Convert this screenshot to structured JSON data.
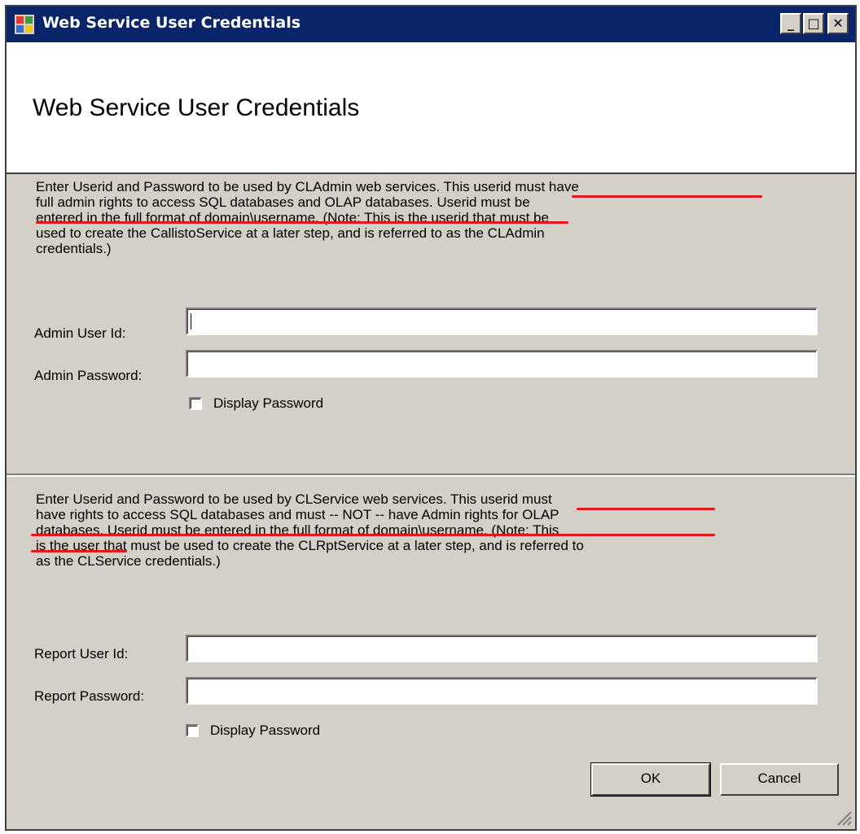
{
  "window": {
    "title": "Web Service User Credentials",
    "controls": {
      "minimize": "_",
      "maximize": "□",
      "close": "✕"
    }
  },
  "header": {
    "title": "Web Service User Credentials"
  },
  "admin_section": {
    "description": [
      "Enter Userid and Password to be used by CLAdmin web services.  This userid must have",
      "full admin rights to access SQL databases and OLAP databases.  Userid must be",
      "entered in the full format of domain\\username.  (Note:  This is the userid that must be",
      "used to create the CallistoService at a later step, and is referred to as the CLAdmin",
      "credentials.)"
    ],
    "user_label": "Admin User Id:",
    "user_value": "",
    "password_label": "Admin Password:",
    "password_value": "",
    "display_password_label": "Display Password",
    "display_password_checked": false
  },
  "report_section": {
    "description": [
      "Enter Userid and Password to be used by CLService web services.  This userid must",
      "have rights to access SQL databases and must -- NOT -- have Admin rights for OLAP",
      "databases.  Userid must be entered in the full format of domain\\username.  (Note:  This",
      "is the user that must be used to create the CLRptService at a later step, and is referred to",
      "as the CLService credentials.)"
    ],
    "user_label": "Report User Id:",
    "user_value": "",
    "password_label": "Report Password:",
    "password_value": "",
    "display_password_label": "Display Password",
    "display_password_checked": false
  },
  "buttons": {
    "ok": "OK",
    "cancel": "Cancel"
  },
  "icons": {
    "app": "app-icon",
    "minimize": "minimize-icon",
    "maximize": "maximize-icon",
    "close": "close-icon",
    "grip": "resize-grip-icon"
  },
  "colors": {
    "titlebar": "#0a246a",
    "dialog_face": "#d4d0c8",
    "annotation_underline": "#e01818"
  }
}
